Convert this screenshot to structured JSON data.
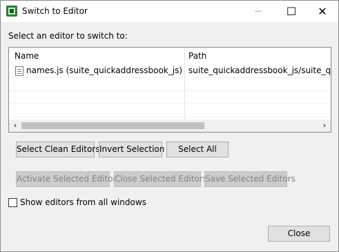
{
  "window": {
    "title": "Switch to Editor",
    "minimize": "─",
    "maximize": "☐",
    "close": "✕"
  },
  "prompt": "Select an editor to switch to:",
  "table": {
    "columns": [
      "Name",
      "Path"
    ],
    "rows": [
      {
        "name": "names.js (suite_quickaddressbook_js)",
        "path": "suite_quickaddressbook_js/suite_quickaddressbook_js/names.js"
      }
    ]
  },
  "scroll": {
    "left": "‹",
    "right": "›"
  },
  "buttons": {
    "select_clean": "Select Clean Editors",
    "invert": "Invert Selection",
    "select_all": "Select All",
    "activate": "Activate Selected Editor",
    "close_selected": "Close Selected Editors",
    "save_selected": "Save Selected Editors",
    "close": "Close"
  },
  "show_all_windows": {
    "label": "Show editors from all windows",
    "checked": false
  }
}
